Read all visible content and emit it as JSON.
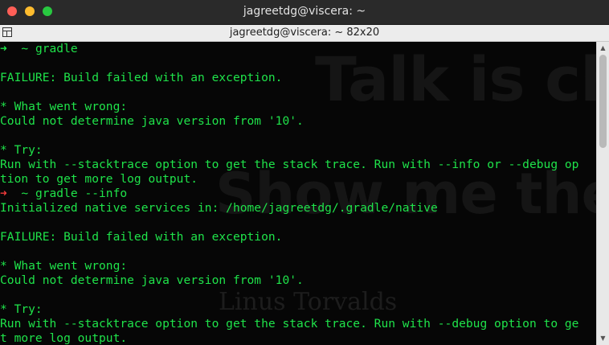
{
  "window": {
    "title": "jagreetdg@viscera: ~"
  },
  "tab": {
    "title": "jagreetdg@viscera: ~ 82x20"
  },
  "wallpaper": {
    "line1": "Talk is cheap.",
    "line2": "Show me the code.",
    "author": "Linus Torvalds"
  },
  "terminal": {
    "prompt_arrow": "➜",
    "lines": [
      {
        "arrow": "➜",
        "arrow_color": "green",
        "text": "  ~ gradle"
      },
      {
        "text": ""
      },
      {
        "text": "FAILURE: Build failed with an exception."
      },
      {
        "text": ""
      },
      {
        "text": "* What went wrong:"
      },
      {
        "text": "Could not determine java version from '10'."
      },
      {
        "text": ""
      },
      {
        "text": "* Try:"
      },
      {
        "text": "Run with --stacktrace option to get the stack trace. Run with --info or --debug op"
      },
      {
        "text": "tion to get more log output."
      },
      {
        "arrow": "➜",
        "arrow_color": "red",
        "text": "  ~ gradle --info"
      },
      {
        "text": "Initialized native services in: /home/jagreetdg/.gradle/native"
      },
      {
        "text": ""
      },
      {
        "text": "FAILURE: Build failed with an exception."
      },
      {
        "text": ""
      },
      {
        "text": "* What went wrong:"
      },
      {
        "text": "Could not determine java version from '10'."
      },
      {
        "text": ""
      },
      {
        "text": "* Try:"
      },
      {
        "text": "Run with --stacktrace option to get the stack trace. Run with --debug option to ge"
      },
      {
        "text": "t more log output."
      }
    ]
  },
  "colors": {
    "terminal_text": "#1fe34a",
    "prompt_error_arrow": "#f03a3a",
    "background": "#060606"
  },
  "scrollbar": {
    "up_icon": "triangle-up-icon",
    "down_icon": "triangle-down-icon"
  }
}
